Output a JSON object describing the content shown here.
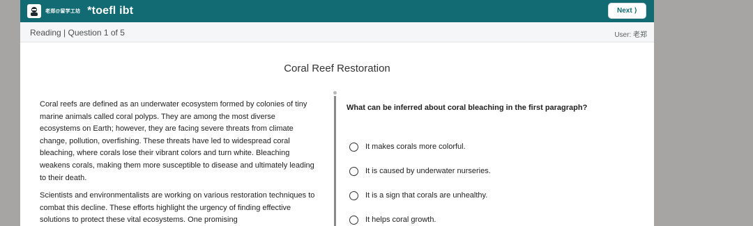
{
  "header": {
    "brand_cn": "老郑@留学工坊",
    "logo": "*toefl ibt",
    "next_label": "Next ⟩"
  },
  "subheader": {
    "breadcrumb": "Reading | Question 1 of 5",
    "user": "User: 老郑"
  },
  "passage": {
    "title": "Coral Reef Restoration",
    "paragraphs": [
      "Coral reefs are defined as an underwater ecosystem formed by colonies of tiny marine animals called coral polyps. They are among the most diverse ecosystems on Earth; however, they are facing severe threats from climate change, pollution, overfishing. These threats have led to widespread coral bleaching, where corals lose their vibrant colors and turn white. Bleaching weakens corals, making them more susceptible to disease and ultimately leading to their death.",
      "Scientists and environmentalists are working on various restoration techniques to combat this decline. These efforts highlight the urgency of finding effective solutions to protect these vital ecosystems. One promising"
    ]
  },
  "question": {
    "text": "What can be inferred about coral bleaching in the first paragraph?",
    "options": [
      "It makes corals more colorful.",
      "It is caused by underwater nurseries.",
      "It is a sign that corals are unhealthy.",
      "It helps coral growth."
    ]
  },
  "colors": {
    "header_bg": "#126a73",
    "page_bg": "#a7a5a3"
  },
  "icons": {
    "avatar": "avatar-icon",
    "radio": "radio-icon"
  }
}
